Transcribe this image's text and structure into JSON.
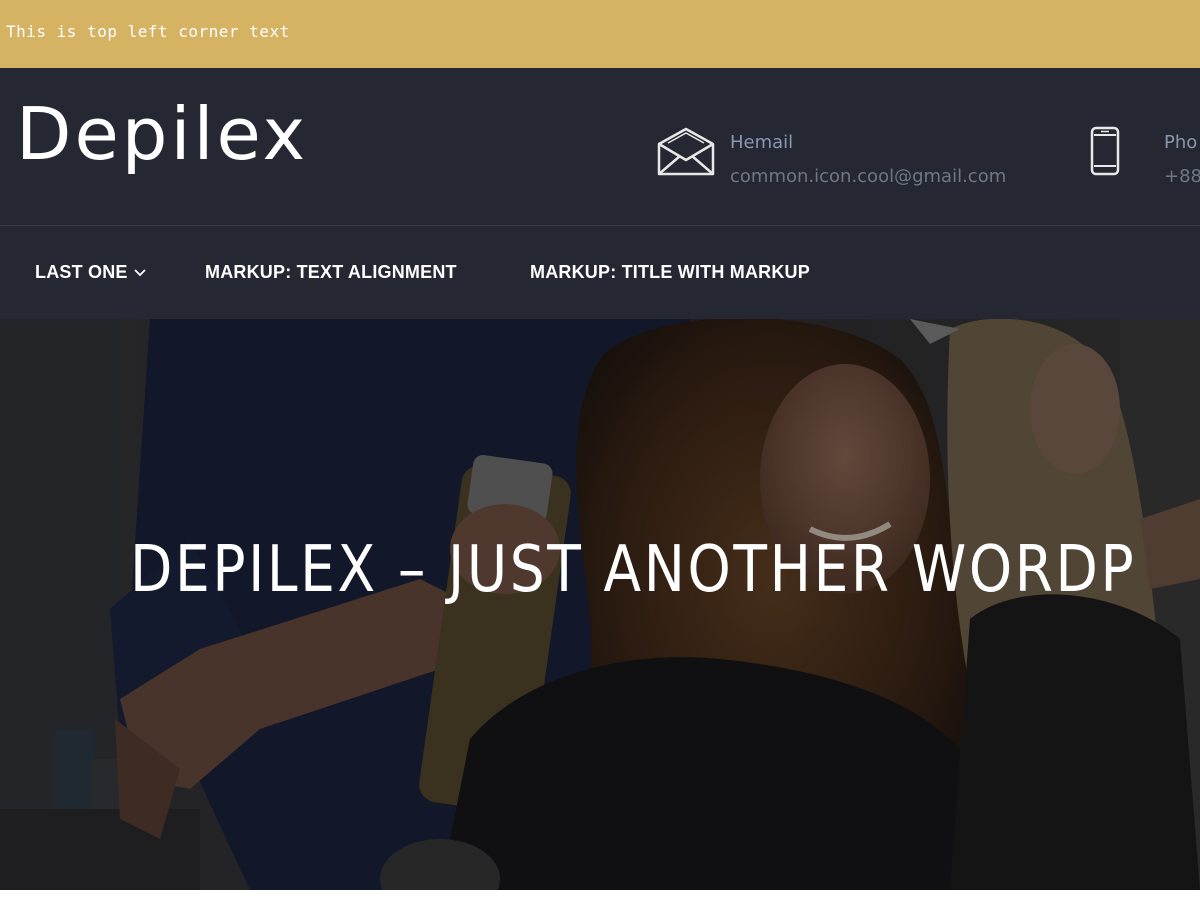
{
  "topbar": {
    "text": "This is top left corner text",
    "color": "#d6b263"
  },
  "header": {
    "logo": "Depilex",
    "background": "#252833",
    "email": {
      "icon": "envelope-icon",
      "label": "Hemail",
      "value": "common.icon.cool@gmail.com"
    },
    "phone": {
      "icon": "mobile-phone-icon",
      "label": "Pho",
      "value": "+88"
    }
  },
  "nav": {
    "items": [
      {
        "label": "LAST ONE",
        "has_dropdown": true
      },
      {
        "label": "MARKUP: TEXT ALIGNMENT",
        "has_dropdown": false
      },
      {
        "label": "MARKUP: TITLE WITH MARKUP",
        "has_dropdown": false
      }
    ]
  },
  "hero": {
    "title": "DEPILEX – JUST ANOTHER WORDP"
  }
}
